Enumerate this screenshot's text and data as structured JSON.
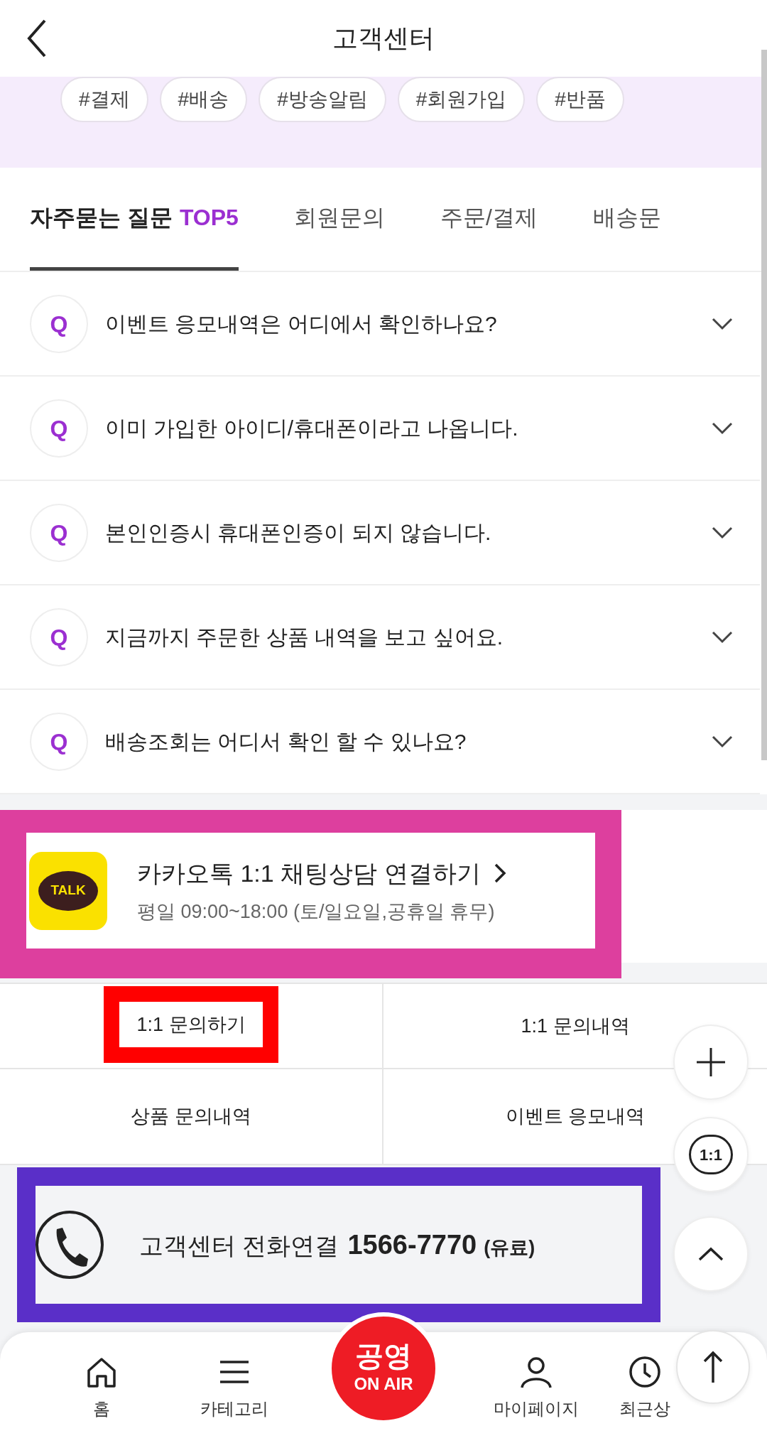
{
  "header": {
    "title": "고객센터"
  },
  "hashtags": [
    "#결제",
    "#배송",
    "#방송알림",
    "#회원가입",
    "#반품"
  ],
  "tabs": [
    {
      "label": "자주묻는 질문",
      "accent": "TOP5",
      "selected": true
    },
    {
      "label": "회원문의",
      "selected": false
    },
    {
      "label": "주문/결제",
      "selected": false
    },
    {
      "label": "배송문",
      "selected": false
    }
  ],
  "faq": [
    {
      "badge": "Q",
      "question": "이벤트 응모내역은 어디에서 확인하나요?",
      "expanded": false
    },
    {
      "badge": "Q",
      "question": "이미 가입한 아이디/휴대폰이라고 나옵니다.",
      "expanded": false
    },
    {
      "badge": "Q",
      "question": "본인인증시 휴대폰인증이 되지 않습니다.",
      "expanded": false
    },
    {
      "badge": "Q",
      "question": "지금까지 주문한 상품 내역을 보고 싶어요.",
      "expanded": false
    },
    {
      "badge": "Q",
      "question": "배송조회는 어디서 확인 할 수 있나요?",
      "expanded": false
    }
  ],
  "kakao": {
    "icon_text": "TALK",
    "title": "카카오톡 1:1 채팅상담 연결하기",
    "hours": "평일 09:00~18:00 (토/일요일,공휴일 휴무)"
  },
  "inquiry_links": [
    {
      "label": "1:1 문의하기",
      "highlighted": true
    },
    {
      "label": "1:1 문의내역",
      "highlighted": false
    },
    {
      "label": "상품 문의내역",
      "highlighted": false
    },
    {
      "label": "이벤트 응모내역",
      "highlighted": false
    }
  ],
  "phone": {
    "label": "고객센터 전화연결",
    "number": "1566-7770",
    "note": "(유료)"
  },
  "floating_buttons": [
    {
      "kind": "plus"
    },
    {
      "kind": "chat",
      "label": "1:1"
    },
    {
      "kind": "top"
    }
  ],
  "bottom_nav": [
    {
      "kind": "home",
      "label": "홈"
    },
    {
      "kind": "menu",
      "label": "카테고리"
    },
    {
      "kind": "live",
      "label": "공영",
      "sublabel": "ON AIR"
    },
    {
      "kind": "person",
      "label": "마이페이지"
    },
    {
      "kind": "clock",
      "label": "최근상"
    }
  ]
}
